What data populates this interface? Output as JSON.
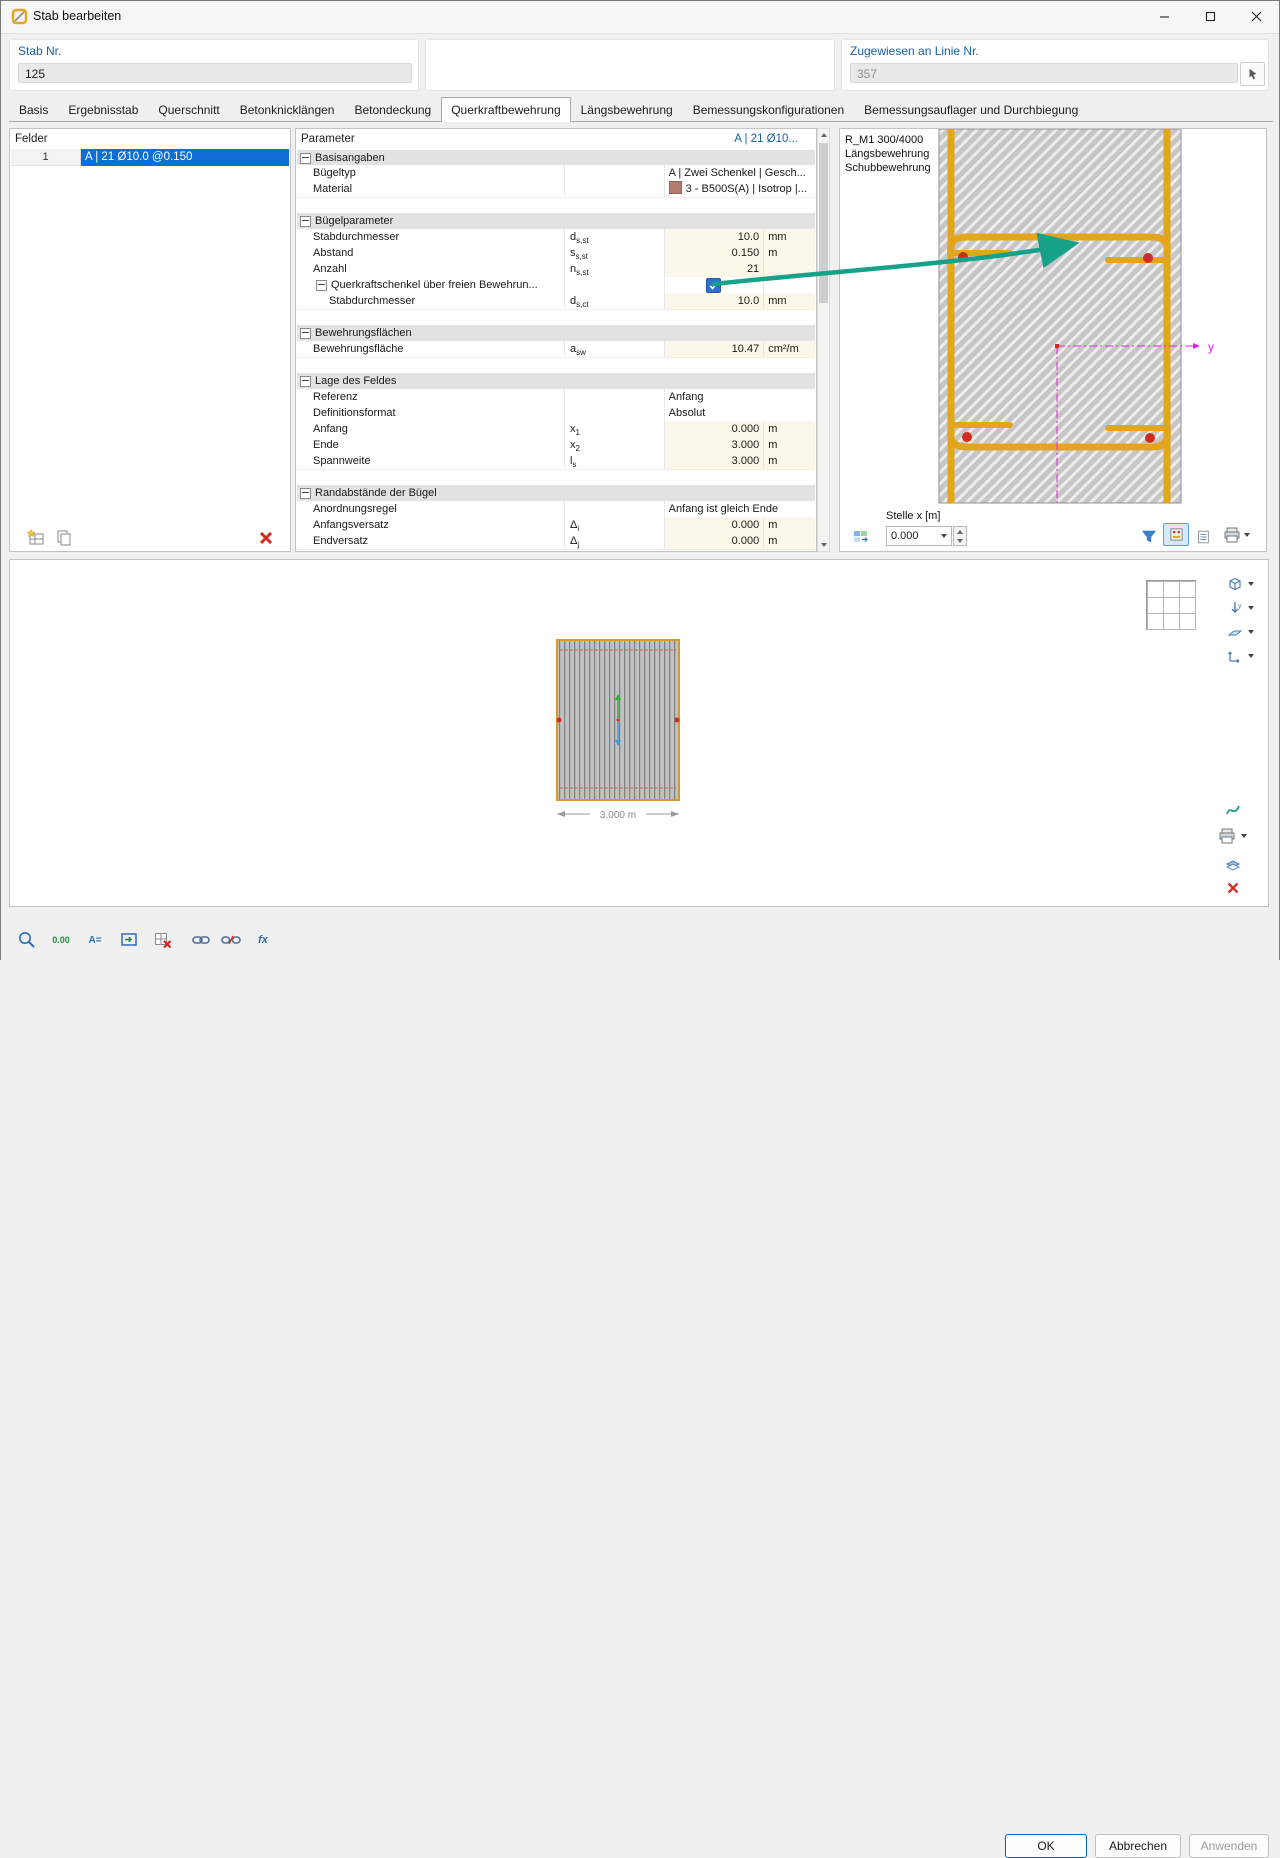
{
  "colors": {
    "accent": "#1a60a8",
    "selection": "#0e6ed5",
    "stirrup": "#e3a41e",
    "rebar": "#d02b1d",
    "magenta": "#e520e5",
    "arrow": "#16a189",
    "cream": "#fbf8e9",
    "swatch": "#b37a6e"
  },
  "window": {
    "title": "Stab bearbeiten"
  },
  "header": {
    "stab_label": "Stab Nr.",
    "stab_value": "125",
    "linie_label": "Zugewiesen an Linie Nr.",
    "linie_value": "357"
  },
  "tabs": [
    {
      "label": "Basis"
    },
    {
      "label": "Ergebnisstab"
    },
    {
      "label": "Querschnitt"
    },
    {
      "label": "Betonknicklängen"
    },
    {
      "label": "Betondeckung"
    },
    {
      "label": "Querkraftbewehrung"
    },
    {
      "label": "Längsbewehrung"
    },
    {
      "label": "Bemessungskonfigurationen"
    },
    {
      "label": "Bemessungsauflager und Durchbiegung"
    }
  ],
  "felder": {
    "title": "Felder",
    "row_num": "1",
    "row_label": "A | 21 Ø10.0 @0.150"
  },
  "params": {
    "title": "Parameter",
    "selection": "A | 21 Ø10...",
    "g_basis": {
      "title": "Basisangaben"
    },
    "buegeltyp": {
      "name": "Bügeltyp",
      "value": "A | Zwei Schenkel | Gesch..."
    },
    "material": {
      "name": "Material",
      "value": "3 - B500S(A) | Isotrop |..."
    },
    "g_buegel": {
      "title": "Bügelparameter"
    },
    "d_sst": {
      "name": "Stabdurchmesser",
      "sym": "d",
      "sub": "s,st",
      "value": "10.0",
      "unit": "mm"
    },
    "s_sst": {
      "name": "Abstand",
      "sym": "s",
      "sub": "s,st",
      "value": "0.150",
      "unit": "m"
    },
    "n_sst": {
      "name": "Anzahl",
      "sym": "n",
      "sub": "s,st",
      "value": "21",
      "unit": ""
    },
    "querkraftschenkel": {
      "name": "Querkraftschenkel über freien Bewehrun...",
      "checked": true
    },
    "d_sct": {
      "name": "Stabdurchmesser",
      "sym": "d",
      "sub": "s,ct",
      "value": "10.0",
      "unit": "mm"
    },
    "g_flaechen": {
      "title": "Bewehrungsflächen"
    },
    "a_sw": {
      "name": "Bewehrungsfläche",
      "sym": "a",
      "sub": "sw",
      "value": "10.47",
      "unit": "cm²/m"
    },
    "g_lage": {
      "title": "Lage des Feldes"
    },
    "referenz": {
      "name": "Referenz",
      "value": "Anfang"
    },
    "defformat": {
      "name": "Definitionsformat",
      "value": "Absolut"
    },
    "anfang": {
      "name": "Anfang",
      "sym": "x",
      "sub": "1",
      "value": "0.000",
      "unit": "m"
    },
    "ende": {
      "name": "Ende",
      "sym": "x",
      "sub": "2",
      "value": "3.000",
      "unit": "m"
    },
    "spannweite": {
      "name": "Spannweite",
      "sym": "l",
      "sub": "s",
      "value": "3.000",
      "unit": "m"
    },
    "g_rand": {
      "title": "Randabstände der Bügel"
    },
    "anordnung": {
      "name": "Anordnungsregel",
      "value": "Anfang ist gleich Ende"
    },
    "anfangsversatz": {
      "name": "Anfangsversatz",
      "sym": "Δ",
      "sub": "i",
      "value": "0.000",
      "unit": "m"
    },
    "endversatz": {
      "name": "Endversatz",
      "sym": "Δ",
      "sub": "j",
      "value": "0.000",
      "unit": "m"
    }
  },
  "preview": {
    "line1": "R_M1 300/4000",
    "line2": "Längsbewehrung",
    "line3": "Schubbewehrung",
    "axis_label": "y",
    "stelle_label": "Stelle x [m]",
    "stelle_value": "0.000"
  },
  "section_view": {
    "dimension": "3.000 m"
  },
  "toolbar": {
    "decimals": "0.00",
    "units": "A=",
    "function": "fx"
  },
  "buttons": {
    "ok": "OK",
    "cancel": "Abbrechen",
    "apply": "Anwenden"
  }
}
